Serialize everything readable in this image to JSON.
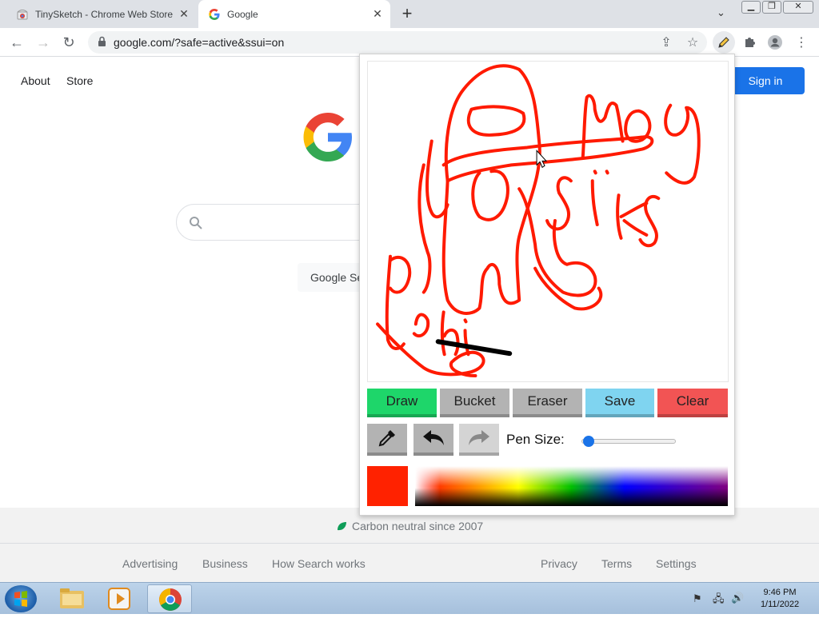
{
  "browser": {
    "tabs": [
      {
        "label": "TinySketch - Chrome Web Store",
        "active": false
      },
      {
        "label": "Google",
        "active": true
      }
    ],
    "new_tab_symbol": "+",
    "url": "google.com/?safe=active&ssui=on"
  },
  "google": {
    "top_links": [
      "About",
      "Store"
    ],
    "sign_in": "Sign in",
    "search_button": "Google Search",
    "carbon": "Carbon neutral since 2007",
    "footer_left": [
      "Advertising",
      "Business",
      "How Search works"
    ],
    "footer_right": [
      "Privacy",
      "Terms",
      "Settings"
    ]
  },
  "tinysketch": {
    "tools": [
      {
        "label": "Draw",
        "color": "#1ed66a"
      },
      {
        "label": "Bucket",
        "color": "#b3b3b3"
      },
      {
        "label": "Eraser",
        "color": "#b3b3b3"
      },
      {
        "label": "Save",
        "color": "#7fd4f0"
      },
      {
        "label": "Clear",
        "color": "#f25454"
      }
    ],
    "icon_buttons": [
      "eyedropper-icon",
      "undo-icon",
      "redo-icon"
    ],
    "pen_size_label": "Pen Size:",
    "pen_size_level": 0.05,
    "current_color": "#ff2200",
    "drawing_color": "#ff1a00"
  },
  "taskbar": {
    "time": "9:46 PM",
    "date": "1/11/2022"
  },
  "colors": {
    "google_blue": "#1a73e8",
    "tabstrip": "#dee1e6"
  }
}
